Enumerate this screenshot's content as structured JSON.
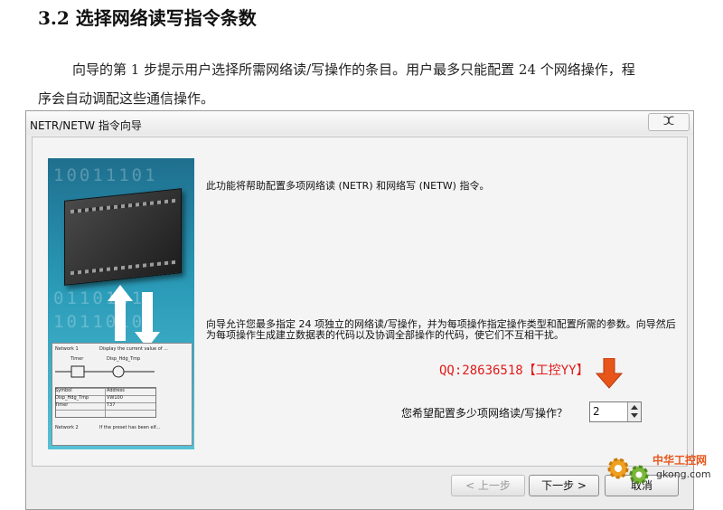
{
  "document": {
    "heading": "3.2  选择网络读写指令条数",
    "paragraph_line1": "向导的第 1 步提示用户选择所需网络读/写操作的条目。用户最多只能配置 24 个网络操作，程",
    "paragraph_line2": "序会自动调配这些通信操作。"
  },
  "dialog": {
    "title": "NETR/NETW 指令向导",
    "close_label": "ⵋ",
    "intro_text": "此功能将帮助配置多项网络读 (NETR) 和网络写 (NETW) 指令。",
    "description": "向导允许您最多指定 24 项独立的网络读/写操作，并为每项操作指定操作类型和配置所需的参数。向导然后为每项操作生成建立数据表的代码以及协调全部操作的代码，使它们不互相干扰。",
    "watermark": "QQ:28636518【工控YY】",
    "question": "您希望配置多少项网络读/写操作？",
    "count_value": "2",
    "buttons": {
      "prev": "< 上一步",
      "next": "下一步 >",
      "cancel": "取消"
    },
    "illustration": {
      "bits_1": "10011101",
      "bits_2": "0110101",
      "bits_3": "1011010",
      "ladder": {
        "row1_left": "Network 1",
        "row1_right": "Display the current value of ...",
        "row2_left": "Timer",
        "row2_right": "Disp_Hdg_Tmp",
        "row3": "Symbol",
        "row3_right": "Address",
        "row4": "Disp_Hdg_Tmp",
        "row4_right": "VW100",
        "row5": "Timer",
        "row5_right": "T37",
        "row6_left": "Network 2",
        "row6_right": "If the preset has been elf..."
      }
    }
  },
  "logo": {
    "name_cn": "中华工控网",
    "domain": "gkong.com"
  },
  "colors": {
    "watermark": "#e21b1b",
    "logo_orange": "#e8551a",
    "art_top": "#1f6f8e",
    "art_bottom": "#56c1d6"
  }
}
